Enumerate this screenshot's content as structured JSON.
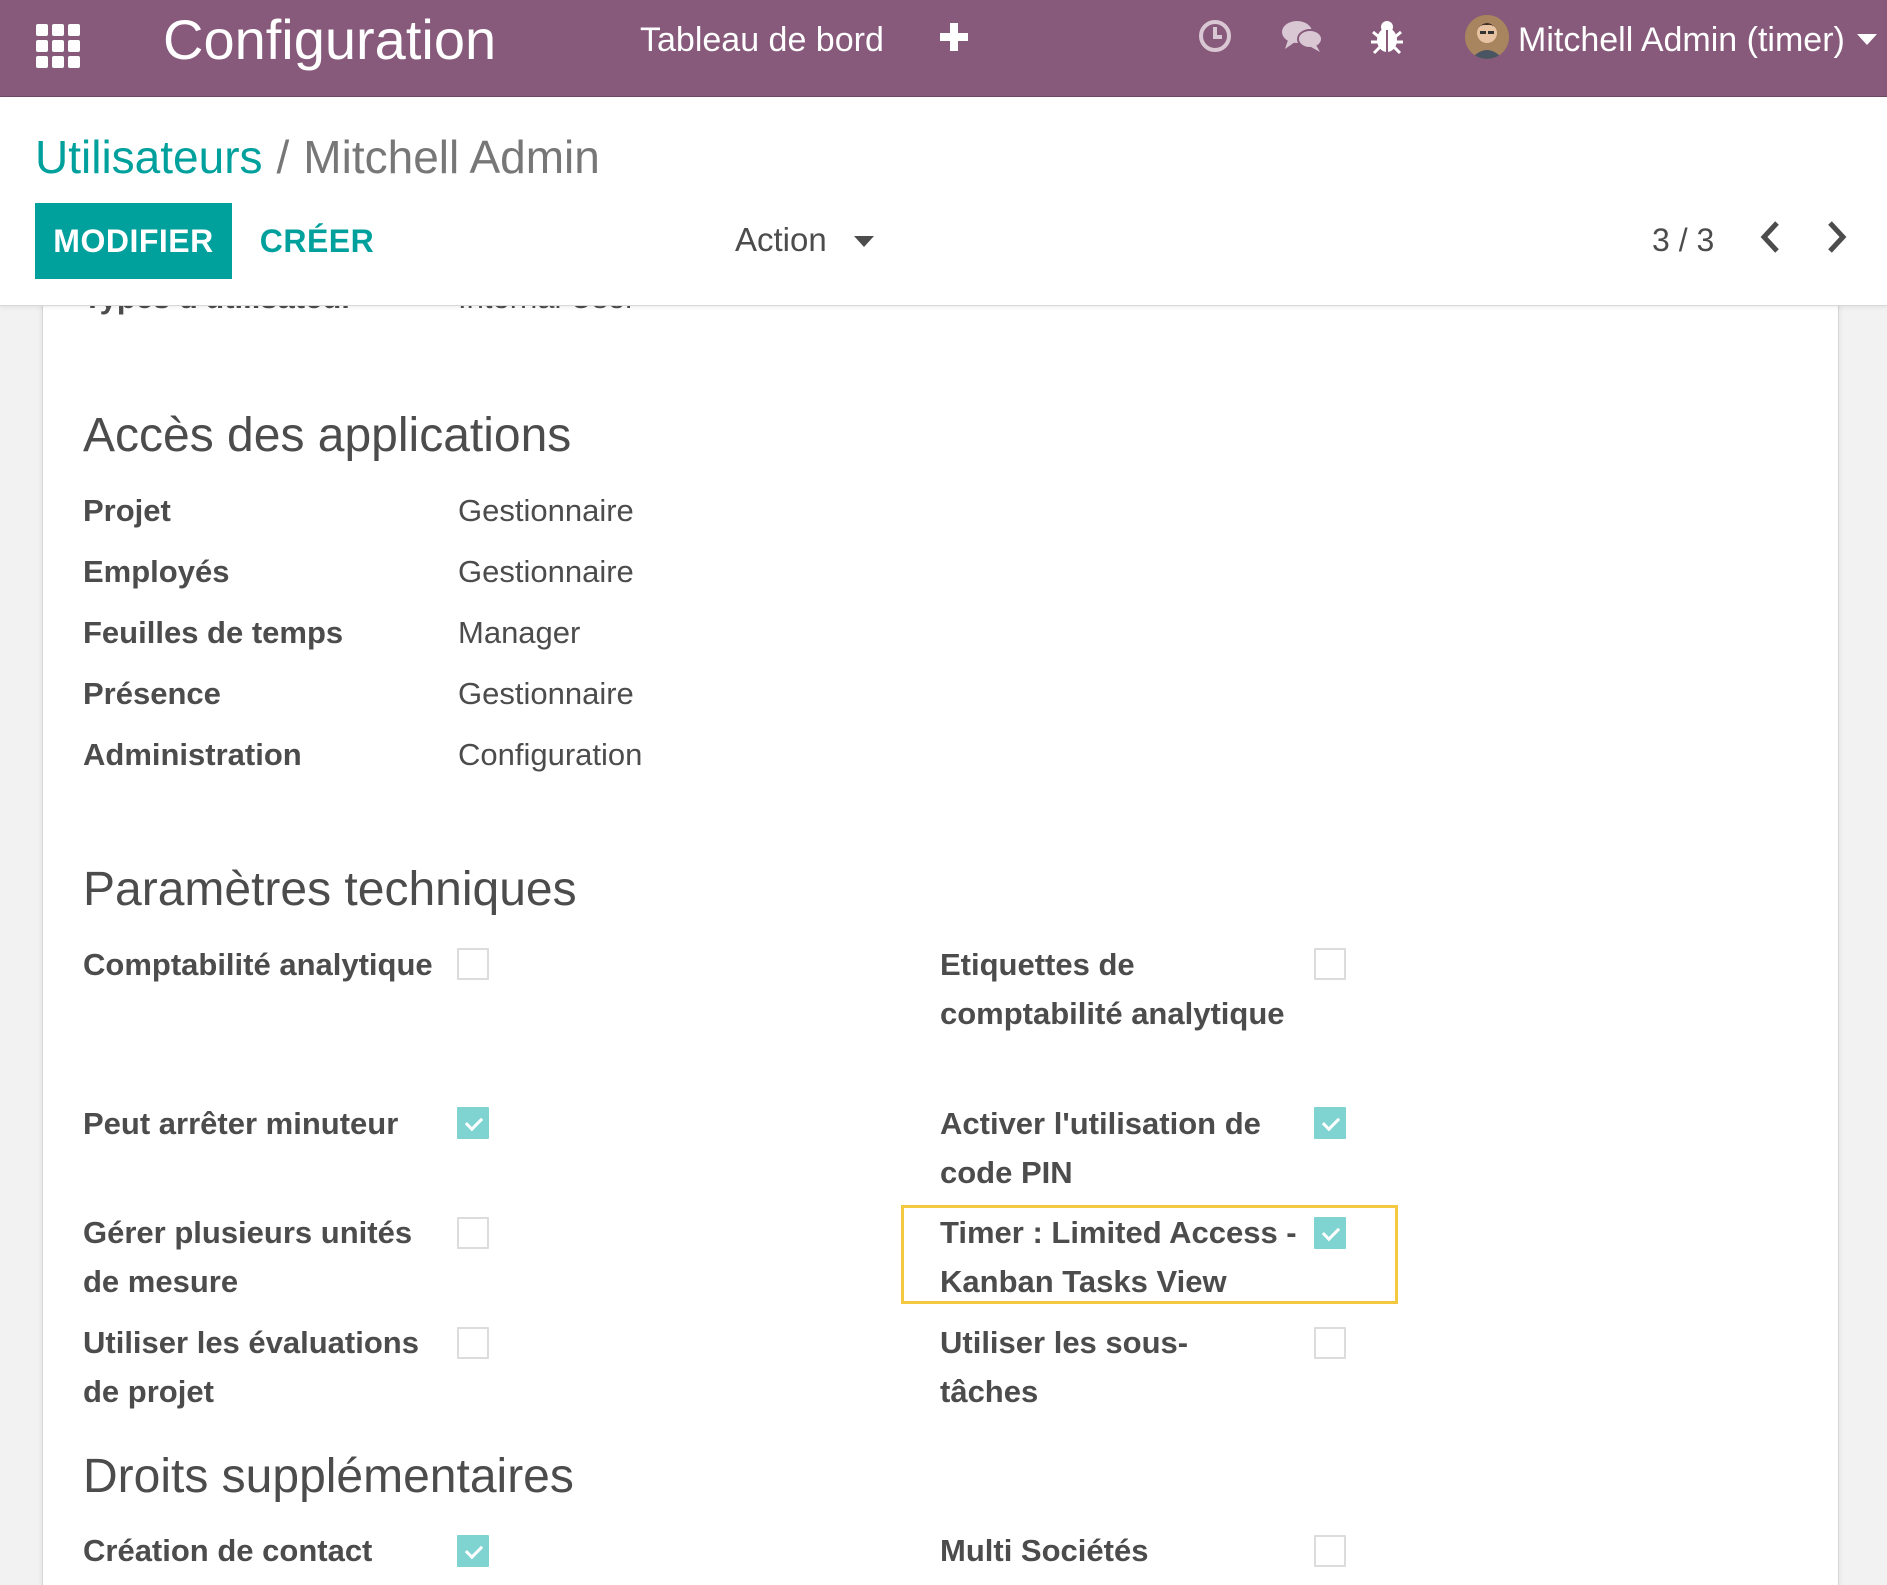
{
  "navbar": {
    "app_title": "Configuration",
    "menu_item": "Tableau de bord",
    "icons": [
      "apps-grid-icon",
      "plus-icon",
      "clock-icon",
      "chat-icon",
      "bug-icon",
      "user-avatar",
      "caret-down-icon"
    ],
    "user_name": "Mitchell Admin (timer)",
    "bg_color": "#875a7b"
  },
  "breadcrumb": {
    "parent": "Utilisateurs",
    "separator": "/",
    "current": "Mitchell Admin"
  },
  "toolbar": {
    "edit_label": "MODIFIER",
    "create_label": "CRÉER",
    "action_label": "Action",
    "accent_color": "#00a09d"
  },
  "pager": {
    "value": "3 / 3"
  },
  "partial_row": {
    "label": "Types d'utilisateur",
    "value": "Internal User"
  },
  "app_access": {
    "title": "Accès des applications",
    "rows": [
      {
        "label": "Projet",
        "value": "Gestionnaire"
      },
      {
        "label": "Employés",
        "value": "Gestionnaire"
      },
      {
        "label": "Feuilles de temps",
        "value": "Manager"
      },
      {
        "label": "Présence",
        "value": "Gestionnaire"
      },
      {
        "label": "Administration",
        "value": "Configuration"
      }
    ]
  },
  "technical": {
    "title": "Paramètres techniques",
    "left": [
      {
        "label": "Comptabilité analytique",
        "checked": false
      },
      {
        "label": "Peut arrêter minuteur",
        "checked": true
      },
      {
        "label": "Gérer plusieurs unités de mesure",
        "checked": false
      },
      {
        "label": "Utiliser les évaluations de projet",
        "checked": false
      }
    ],
    "right": [
      {
        "label": "Etiquettes de comptabilité analytique",
        "checked": false
      },
      {
        "label": "Activer l'utilisation de code PIN",
        "checked": true
      },
      {
        "label": "Timer : Limited Access - Kanban Tasks View",
        "checked": true,
        "highlighted": true
      },
      {
        "label": "Utiliser les sous-tâches",
        "checked": false
      }
    ]
  },
  "extra_rights": {
    "title": "Droits supplémentaires",
    "left": [
      {
        "label": "Création de contact",
        "checked": true
      }
    ],
    "right": [
      {
        "label": "Multi Sociétés",
        "checked": false
      }
    ]
  }
}
